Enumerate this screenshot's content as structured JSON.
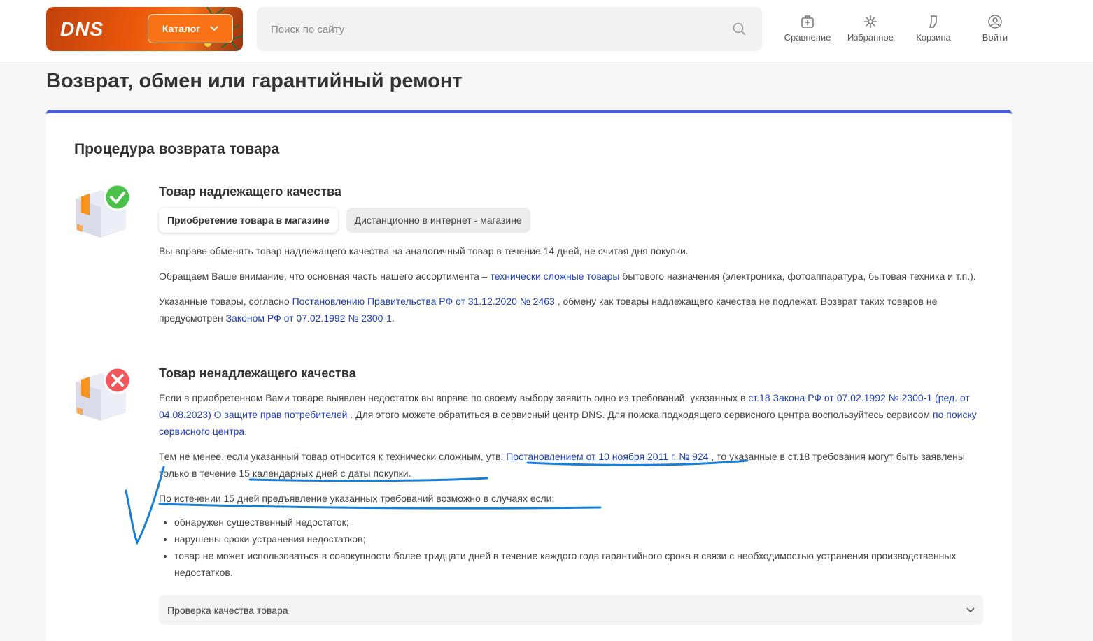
{
  "header": {
    "logo_text": "DNS",
    "catalog_label": "Каталог",
    "search_placeholder": "Поиск по сайту",
    "nav": [
      {
        "label": "Сравнение",
        "icon": "compare-icon"
      },
      {
        "label": "Избранное",
        "icon": "favorite-icon"
      },
      {
        "label": "Корзина",
        "icon": "cart-icon"
      },
      {
        "label": "Войти",
        "icon": "user-icon"
      }
    ]
  },
  "page": {
    "title": "Возврат, обмен или гарантийный ремонт",
    "section_title": "Процедура возврата товара"
  },
  "good": {
    "title": "Товар надлежащего качества",
    "tabs": [
      "Приобретение товара в магазине",
      "Дистанционно в интернет - магазине"
    ],
    "p1": "Вы вправе обменять товар надлежащего качества на аналогичный товар в течение 14 дней, не считая дня покупки.",
    "p2_a": "Обращаем Ваше внимание, что основная часть нашего ассортимента – ",
    "p2_link": "технически сложные товары",
    "p2_b": " бытового назначения (электроника, фотоаппаратура, бытовая техника и т.п.).",
    "p3_a": "Указанные товары, согласно ",
    "p3_link1": "Постановлению Правительства РФ от 31.12.2020 № 2463",
    "p3_b": " , обмену как товары надлежащего качества не подлежат. Возврат таких товаров не предусмотрен ",
    "p3_link2": "Законом РФ от 07.02.1992 № 2300-1",
    "p3_c": "."
  },
  "bad": {
    "title": "Товар ненадлежащего качества",
    "p1_a": "Если в приобретенном Вами товаре выявлен недостаток вы вправе по своему выбору заявить одно из требований, указанных в ",
    "p1_link1": "ст.18 Закона РФ от 07.02.1992 № 2300-1 (ред. от 04.08.2023) О защите прав потребителей",
    "p1_b": " . Для этого можете обратиться в сервисный центр DNS. Для поиска подходящего сервисного центра воспользуйтесь сервисом ",
    "p1_link2": "по поиску сервисного центра",
    "p1_c": ".",
    "p2_a": "Тем не менее, если указанный товар относится к технически сложным, утв. ",
    "p2_link": "Постановлением от 10 ноября 2011 г. № 924",
    "p2_b": " , то указанные в ст.18 требования могут быть заявлены только в течение 15 календарных дней с даты покупки.",
    "p3": "По истечении 15 дней предъявление указанных требований возможно в случаях если:",
    "list": [
      "обнаружен существенный недостаток;",
      "нарушены сроки устранения недостатков;",
      "товар не может использоваться в совокупности более тридцати дней в течение каждого года гарантийного срока в связи с необходимостью устранения производственных недостатков."
    ]
  },
  "accordion": {
    "label": "Проверка качества товара"
  },
  "colors": {
    "accent": "#f97316",
    "link": "#1f3fbf",
    "card_top": "#4a5ecf",
    "annotation": "#1a7fd4"
  }
}
